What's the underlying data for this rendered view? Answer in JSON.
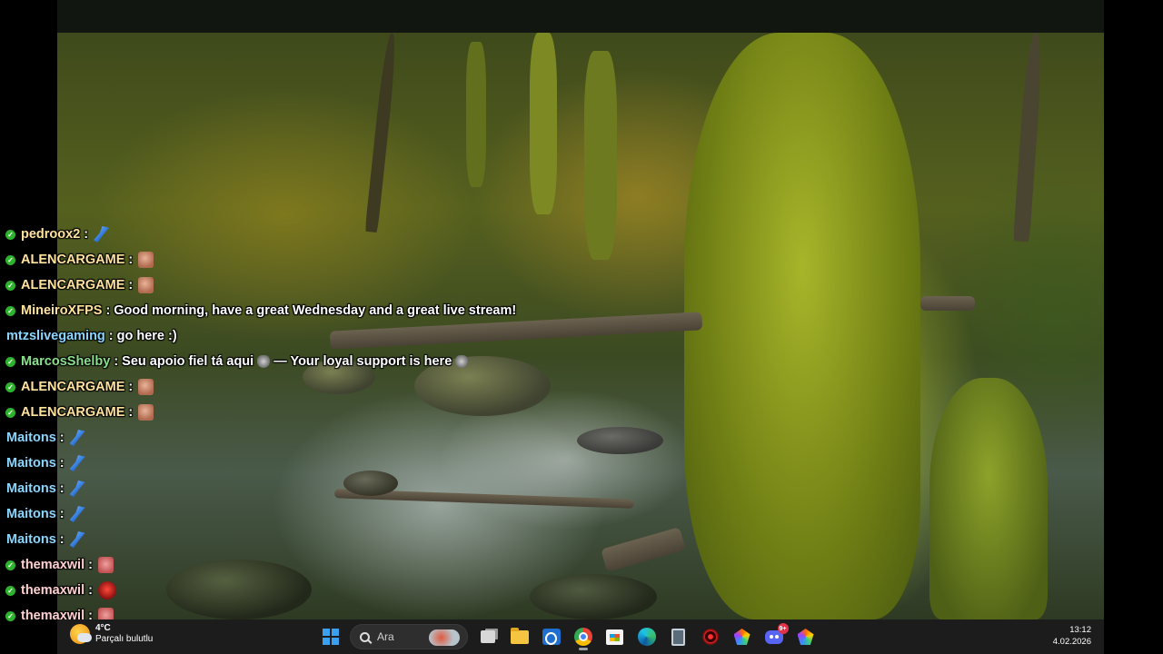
{
  "chat": {
    "messages": [
      {
        "user": "pedroox2",
        "user_color": "#ffe39c",
        "sep": ":",
        "text": "",
        "badge": true,
        "emotes": [
          "feather"
        ]
      },
      {
        "user": "ALENCARGAME",
        "user_color": "#ffe39c",
        "sep": ":",
        "text": "",
        "badge": true,
        "emotes": [
          "face"
        ]
      },
      {
        "user": "ALENCARGAME",
        "user_color": "#ffe39c",
        "sep": ":",
        "text": "",
        "badge": true,
        "emotes": [
          "face"
        ]
      },
      {
        "user": "MineiroXFPS",
        "user_color": "#ffe39c",
        "sep": ":",
        "text": "Good morning, have a great Wednesday and a great live stream!",
        "badge": true,
        "emotes": []
      },
      {
        "user": "mtzslivegaming",
        "user_color": "#8bd6ff",
        "sep": ":",
        "text": "go here :)",
        "badge": false,
        "emotes": []
      },
      {
        "user": "MarcosShelby",
        "user_color": "#8be08b",
        "sep": ":",
        "text": "Seu apoio fiel tá aqui",
        "text2": "— Your loyal support is here",
        "badge": true,
        "emotes": [
          "wolf"
        ]
      },
      {
        "user": "ALENCARGAME",
        "user_color": "#ffe39c",
        "sep": ":",
        "text": "",
        "badge": true,
        "emotes": [
          "face"
        ]
      },
      {
        "user": "ALENCARGAME",
        "user_color": "#ffe39c",
        "sep": ":",
        "text": "",
        "badge": true,
        "emotes": [
          "face"
        ]
      },
      {
        "user": "Maitons",
        "user_color": "#8bd6ff",
        "sep": ":",
        "text": "",
        "badge": false,
        "emotes": [
          "feather"
        ]
      },
      {
        "user": "Maitons",
        "user_color": "#8bd6ff",
        "sep": ":",
        "text": "",
        "badge": false,
        "emotes": [
          "feather"
        ]
      },
      {
        "user": "Maitons",
        "user_color": "#8bd6ff",
        "sep": ":",
        "text": "",
        "badge": false,
        "emotes": [
          "feather"
        ]
      },
      {
        "user": "Maitons",
        "user_color": "#8bd6ff",
        "sep": ":",
        "text": "",
        "badge": false,
        "emotes": [
          "feather"
        ]
      },
      {
        "user": "Maitons",
        "user_color": "#8bd6ff",
        "sep": ":",
        "text": "",
        "badge": false,
        "emotes": [
          "feather"
        ]
      },
      {
        "user": "themaxwil",
        "user_color": "#ffd0d0",
        "sep": ":",
        "text": "",
        "badge": true,
        "emotes": [
          "pink"
        ]
      },
      {
        "user": "themaxwil",
        "user_color": "#ffd0d0",
        "sep": ":",
        "text": "",
        "badge": true,
        "emotes": [
          "red"
        ]
      },
      {
        "user": "themaxwil",
        "user_color": "#ffd0d0",
        "sep": ":",
        "text": "",
        "badge": true,
        "emotes": [
          "pink"
        ]
      }
    ]
  },
  "taskbar": {
    "weather": {
      "temp": "4°C",
      "condition": "Parçalı bulutlu",
      "icon": "partly-cloudy-icon"
    },
    "search_placeholder": "Ara",
    "apps": [
      {
        "name": "start-button",
        "icon": "windows-logo-icon"
      },
      {
        "name": "task-view-button",
        "icon": "task-view-icon"
      },
      {
        "name": "file-explorer-button",
        "icon": "folder-icon"
      },
      {
        "name": "outlook-button",
        "icon": "outlook-icon"
      },
      {
        "name": "chrome-button",
        "icon": "chrome-icon",
        "active": true
      },
      {
        "name": "store-button",
        "icon": "store-icon"
      },
      {
        "name": "edge-button",
        "icon": "edge-icon"
      },
      {
        "name": "calculator-button",
        "icon": "calculator-icon"
      },
      {
        "name": "target-app-button",
        "icon": "target-icon"
      },
      {
        "name": "gem-app-button",
        "icon": "gem-icon"
      },
      {
        "name": "discord-button",
        "icon": "discord-icon"
      },
      {
        "name": "gem-app-2-button",
        "icon": "gem-icon"
      }
    ],
    "discord_badge": "9+",
    "clock": {
      "time": "13:12",
      "date": "4.02.2026"
    }
  },
  "colors": {
    "badge_green": "#2fb32f",
    "taskbar_bg": "#1c1c1c",
    "topbar_bg": "#121610"
  }
}
